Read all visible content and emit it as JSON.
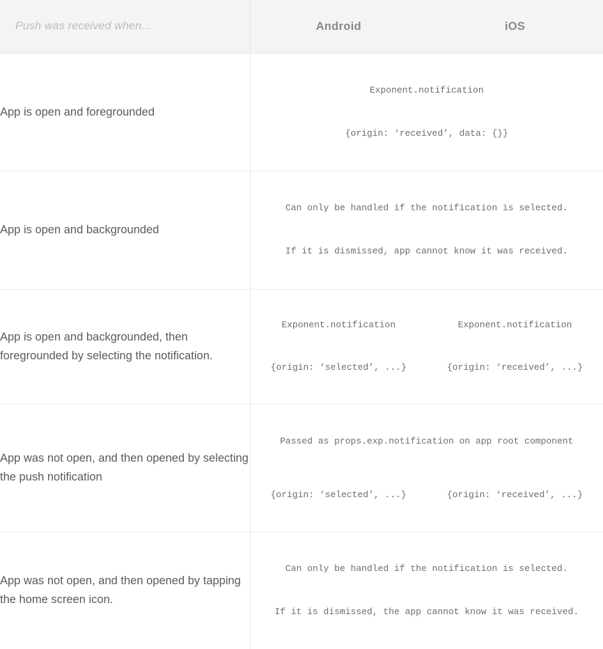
{
  "table": {
    "columns": {
      "scenario_header": "Push was received when...",
      "android_header": "Android",
      "ios_header": "iOS"
    },
    "rows": [
      {
        "scenario": "App is open and foregrounded",
        "detail_type": "spanning",
        "spanning_lines": [
          "Exponent.notification",
          "{origin: ‘received’, data: {}}"
        ]
      },
      {
        "scenario": "App is open and backgrounded",
        "detail_type": "spanning",
        "spanning_lines": [
          "Can only be handled if the notification is selected.",
          "If it is dismissed, app cannot know it was received."
        ]
      },
      {
        "scenario": "App is open and backgrounded, then foregrounded by selecting the notification.",
        "detail_type": "split",
        "android_lines": [
          "Exponent.notification",
          "{origin: ‘selected’, ...}"
        ],
        "ios_lines": [
          "Exponent.notification",
          "{origin: ‘received’, ...}"
        ]
      },
      {
        "scenario": "App was not open, and then opened by selecting the push notification",
        "detail_type": "span-then-split",
        "spanning_line": "Passed as props.exp.notification on app root component",
        "android_line": "{origin: ‘selected’, ...}",
        "ios_line": "{origin: ‘received’, ...}"
      },
      {
        "scenario": "App was not open, and then opened by tapping the home screen icon.",
        "detail_type": "spanning",
        "spanning_lines": [
          "Can only be handled if the notification is selected.",
          "If it is dismissed, the app cannot know it was received."
        ]
      }
    ]
  }
}
